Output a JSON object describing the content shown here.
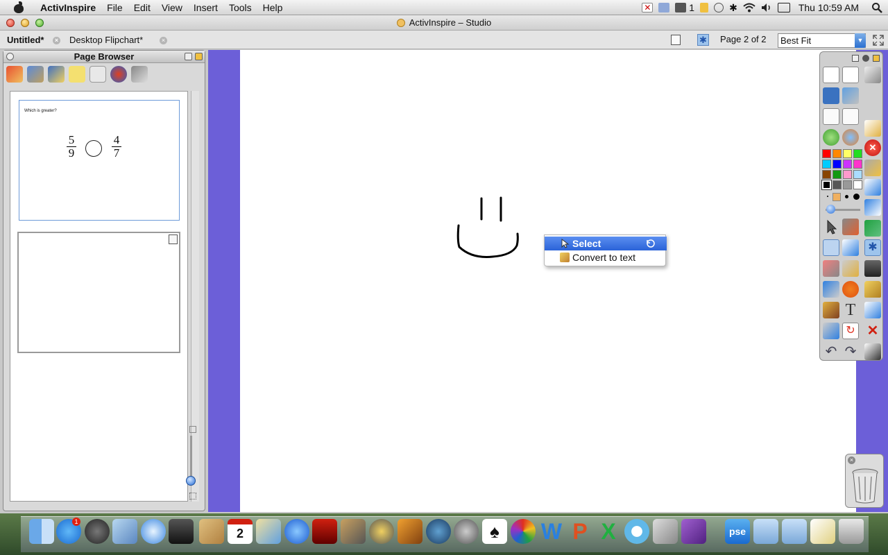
{
  "menubar": {
    "app_name": "ActivInspire",
    "menus": [
      "File",
      "Edit",
      "View",
      "Insert",
      "Tools",
      "Help"
    ],
    "status": {
      "input_indicator": "1",
      "clock": "Thu 10:59 AM"
    }
  },
  "window": {
    "title": "ActivInspire – Studio"
  },
  "tabs": [
    {
      "label": "Untitled*",
      "active": true
    },
    {
      "label": "Desktop Flipchart*",
      "active": false
    }
  ],
  "toolbar": {
    "page_indicator": "Page 2 of 2",
    "zoom_value": "Best Fit"
  },
  "page_browser": {
    "title": "Page Browser",
    "thumbnails": [
      {
        "question": "Which is greater?",
        "fraction_left": {
          "numerator": "5",
          "denominator": "9"
        },
        "fraction_right": {
          "numerator": "4",
          "denominator": "7"
        }
      },
      {
        "question": ""
      }
    ]
  },
  "context_menu": {
    "items": [
      {
        "label": "Select",
        "highlighted": true
      },
      {
        "label": "Convert to text",
        "highlighted": false
      }
    ]
  },
  "colors": {
    "canvas_background": "#6c5fd8",
    "highlight": "#3a72e0",
    "palette": [
      "#ff0000",
      "#ff8800",
      "#ffff66",
      "#22dd22",
      "#00ccff",
      "#0000ff",
      "#cc33ff",
      "#ff33cc",
      "#884400",
      "#119911",
      "#ff99cc",
      "#aaddff",
      "#000000",
      "#555555",
      "#999999",
      "#ffffff"
    ]
  },
  "icons": [
    "apple-icon",
    "close-icon",
    "settings-icon",
    "search-icon",
    "wifi-icon",
    "bluetooth-icon",
    "volume-icon",
    "pen-icon",
    "eraser-icon",
    "text-icon",
    "trash-icon"
  ]
}
